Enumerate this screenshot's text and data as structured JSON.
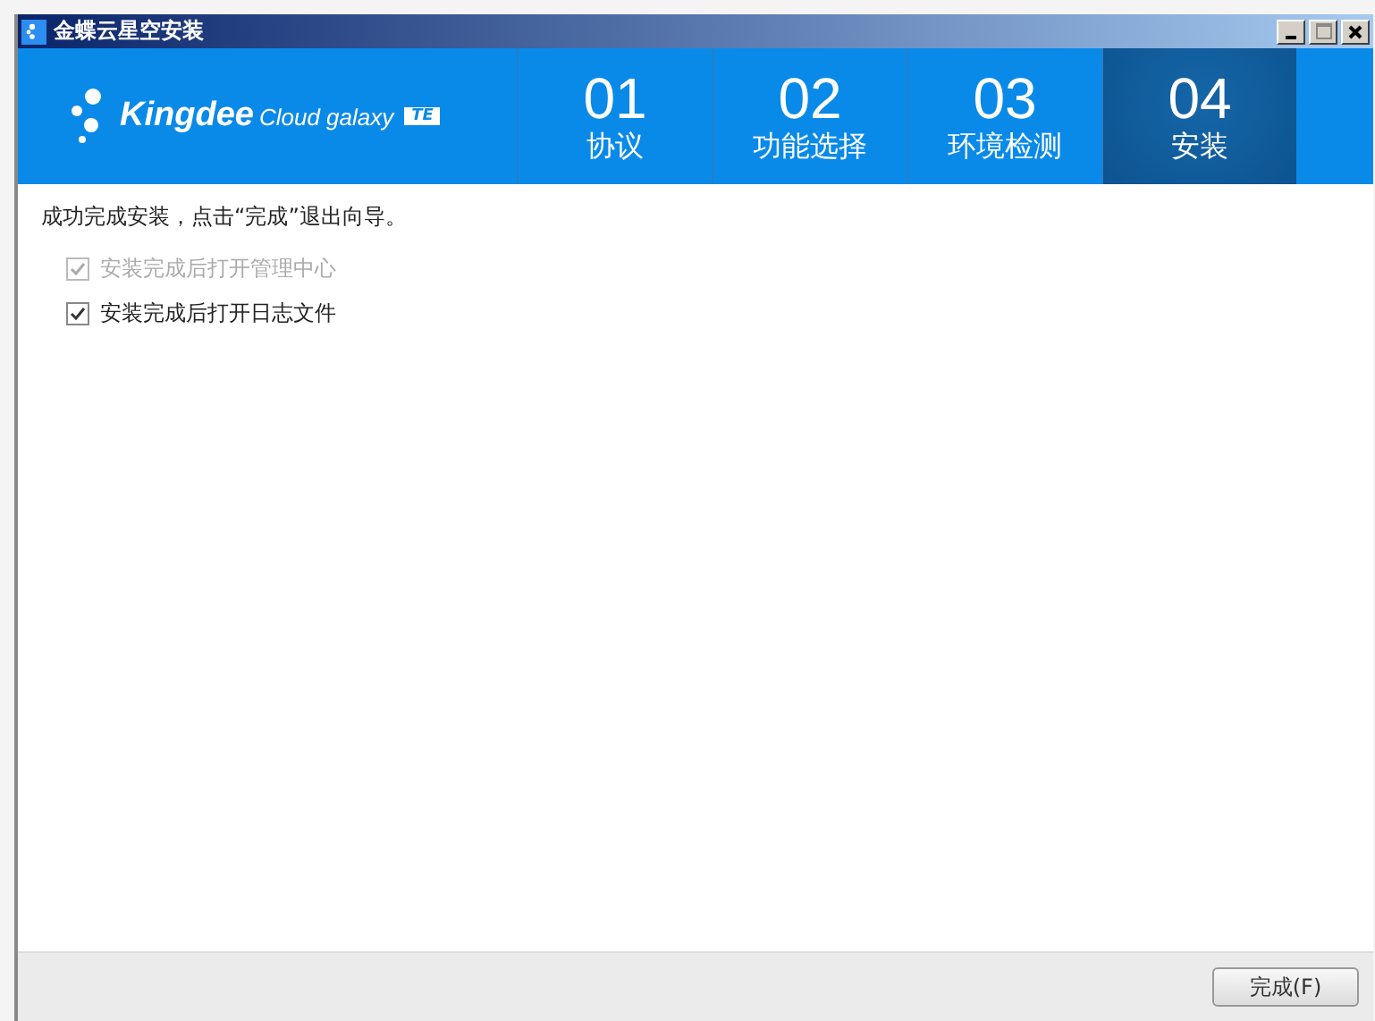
{
  "window": {
    "title": "金蝶云星空安装"
  },
  "logo": {
    "brand": "Kingdee",
    "product": "Cloud galaxy",
    "edition": "TE"
  },
  "steps": [
    {
      "number": "01",
      "label": "协议",
      "selected": false
    },
    {
      "number": "02",
      "label": "功能选择",
      "selected": false
    },
    {
      "number": "03",
      "label": "环境检测",
      "selected": false
    },
    {
      "number": "04",
      "label": "安装",
      "selected": true
    }
  ],
  "message": "成功完成安装，点击“完成”退出向导。",
  "options": [
    {
      "label": "安装完成后打开管理中心",
      "checked": true,
      "disabled": true
    },
    {
      "label": "安装完成后打开日志文件",
      "checked": true,
      "disabled": false
    }
  ],
  "buttons": [
    {
      "label": "完成(F)"
    }
  ]
}
